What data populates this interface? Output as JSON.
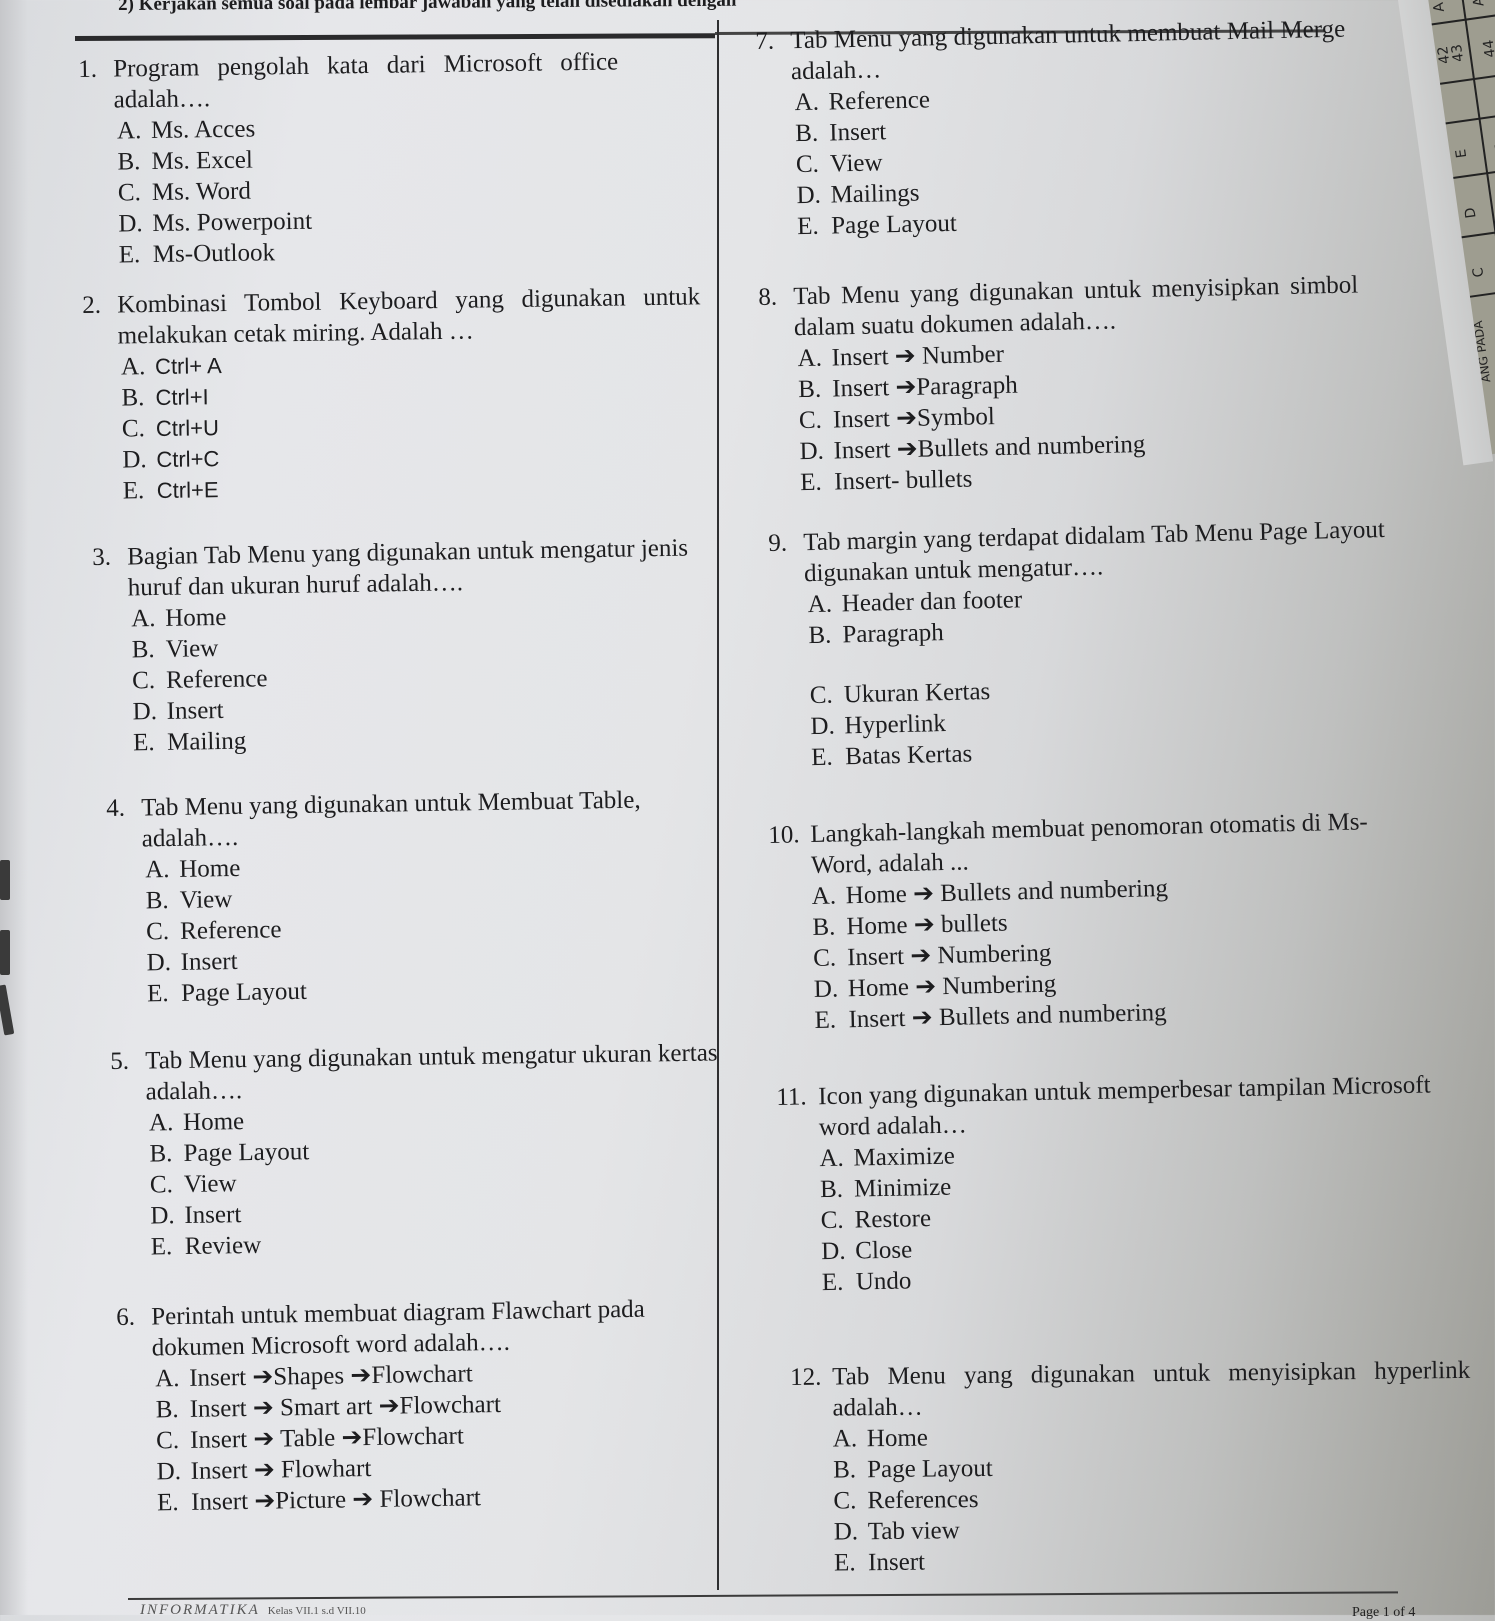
{
  "header": {
    "instruction": "2)   Kerjakan semua soal pada lembar jawaban yang telah disediakan dengan"
  },
  "footer": {
    "subject": "INFORMATIKA",
    "class_info": "Kelas VII.1 s.d VII.10",
    "page": "Page 1 of 4"
  },
  "answer_sheet": {
    "cells": [
      "A",
      "A",
      "42",
      "43",
      "44",
      "E",
      "E",
      "D",
      "D",
      "C"
    ],
    "label": "ANG PADA"
  },
  "questions": [
    {
      "number": "1.",
      "text": "Program pengolah kata dari Microsoft office adalah….",
      "options": [
        {
          "letter": "A.",
          "text": "Ms. Acces"
        },
        {
          "letter": "B.",
          "text": "Ms. Excel"
        },
        {
          "letter": "C.",
          "text": "Ms. Word"
        },
        {
          "letter": "D.",
          "text": "Ms. Powerpoint"
        },
        {
          "letter": "E.",
          "text": "Ms-Outlook"
        }
      ]
    },
    {
      "number": "2.",
      "text": "Kombinasi Tombol Keyboard yang digunakan untuk melakukan cetak miring. Adalah …",
      "options": [
        {
          "letter": "A.",
          "text": "Ctrl+ A"
        },
        {
          "letter": "B.",
          "text": "Ctrl+I"
        },
        {
          "letter": "C.",
          "text": "Ctrl+U"
        },
        {
          "letter": "D.",
          "text": "Ctrl+C"
        },
        {
          "letter": "E.",
          "text": "Ctrl+E"
        }
      ]
    },
    {
      "number": "3.",
      "text": "Bagian Tab Menu  yang digunakan untuk mengatur jenis huruf dan ukuran huruf adalah….",
      "options": [
        {
          "letter": "A.",
          "text": "Home"
        },
        {
          "letter": "B.",
          "text": "View"
        },
        {
          "letter": "C.",
          "text": "Reference"
        },
        {
          "letter": "D.",
          "text": "Insert"
        },
        {
          "letter": "E.",
          "text": "Mailing"
        }
      ]
    },
    {
      "number": "4.",
      "text": "Tab Menu yang digunakan untuk Membuat Table, adalah….",
      "options": [
        {
          "letter": "A.",
          "text": "Home"
        },
        {
          "letter": "B.",
          "text": "View"
        },
        {
          "letter": "C.",
          "text": "Reference"
        },
        {
          "letter": "D.",
          "text": "Insert"
        },
        {
          "letter": "E.",
          "text": "Page Layout"
        }
      ]
    },
    {
      "number": "5.",
      "text": "Tab Menu yang digunakan untuk mengatur ukuran kertas adalah….",
      "options": [
        {
          "letter": "A.",
          "text": "Home"
        },
        {
          "letter": "B.",
          "text": "Page Layout"
        },
        {
          "letter": "C.",
          "text": "View"
        },
        {
          "letter": "D.",
          "text": "Insert"
        },
        {
          "letter": "E.",
          "text": "Review"
        }
      ]
    },
    {
      "number": "6.",
      "text": "Perintah untuk membuat diagram Flawchart pada dokumen Microsoft word adalah….",
      "options": [
        {
          "letter": "A.",
          "text": "Insert ➔Shapes ➔Flowchart"
        },
        {
          "letter": "B.",
          "text": "Insert ➔ Smart art ➔Flowchart"
        },
        {
          "letter": "C.",
          "text": "Insert ➔ Table ➔Flowchart"
        },
        {
          "letter": "D.",
          "text": "Insert ➔ Flowhart"
        },
        {
          "letter": "E.",
          "text": "Insert ➔Picture ➔ Flowchart"
        }
      ]
    },
    {
      "number": "7.",
      "text": "Tab Menu yang digunakan untuk membuat Mail Merge adalah…",
      "options": [
        {
          "letter": "A.",
          "text": "Reference"
        },
        {
          "letter": "B.",
          "text": "Insert"
        },
        {
          "letter": "C.",
          "text": "View"
        },
        {
          "letter": "D.",
          "text": "Mailings"
        },
        {
          "letter": "E.",
          "text": "Page Layout"
        }
      ]
    },
    {
      "number": "8.",
      "text": "Tab Menu yang digunakan untuk menyisipkan simbol dalam suatu dokumen adalah….",
      "options": [
        {
          "letter": "A.",
          "text": "Insert ➔ Number"
        },
        {
          "letter": "B.",
          "text": "Insert ➔Paragraph"
        },
        {
          "letter": "C.",
          "text": "Insert ➔Symbol"
        },
        {
          "letter": "D.",
          "text": "Insert ➔Bullets and numbering"
        },
        {
          "letter": "E.",
          "text": "Insert- bullets"
        }
      ]
    },
    {
      "number": "9.",
      "text": "Tab margin yang terdapat didalam Tab Menu Page Layout  digunakan untuk mengatur….",
      "options": [
        {
          "letter": "A.",
          "text": "Header dan footer"
        },
        {
          "letter": "B.",
          "text": "Paragraph"
        },
        {
          "letter": "C.",
          "text": "Ukuran Kertas"
        },
        {
          "letter": "D.",
          "text": "Hyperlink"
        },
        {
          "letter": "E.",
          "text": "Batas Kertas"
        }
      ]
    },
    {
      "number": "10.",
      "text": "Langkah-langkah membuat penomoran otomatis di Ms-Word, adalah ...",
      "options": [
        {
          "letter": "A.",
          "text": "Home ➔ Bullets and numbering"
        },
        {
          "letter": "B.",
          "text": "Home ➔ bullets"
        },
        {
          "letter": "C.",
          "text": "Insert  ➔ Numbering"
        },
        {
          "letter": "D.",
          "text": "Home ➔ Numbering"
        },
        {
          "letter": "E.",
          "text": "Insert ➔ Bullets and numbering"
        }
      ]
    },
    {
      "number": "11.",
      "text": "Icon yang digunakan untuk memperbesar tampilan Microsoft word adalah…",
      "options": [
        {
          "letter": "A.",
          "text": "Maximize"
        },
        {
          "letter": "B.",
          "text": "Minimize"
        },
        {
          "letter": "C.",
          "text": "Restore"
        },
        {
          "letter": "D.",
          "text": "Close"
        },
        {
          "letter": "E.",
          "text": "Undo"
        }
      ]
    },
    {
      "number": "12.",
      "text": "Tab Menu yang digunakan untuk menyisipkan hyperlink adalah…",
      "options": [
        {
          "letter": "A.",
          "text": "Home"
        },
        {
          "letter": "B.",
          "text": "Page Layout"
        },
        {
          "letter": "C.",
          "text": "References"
        },
        {
          "letter": "D.",
          "text": "Tab view"
        },
        {
          "letter": "E.",
          "text": "Insert"
        }
      ]
    }
  ]
}
